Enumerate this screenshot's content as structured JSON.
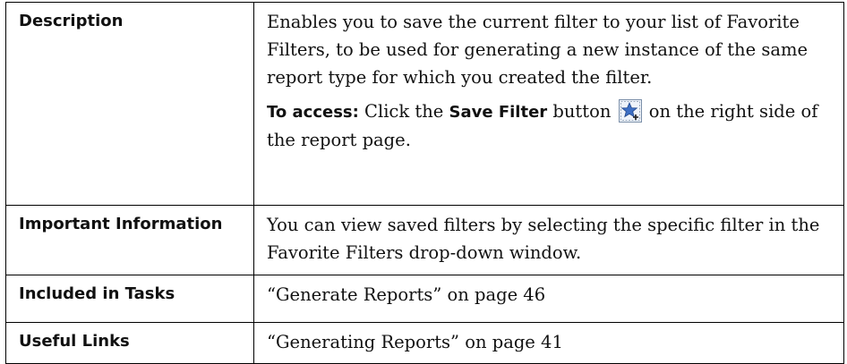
{
  "rows": {
    "description": {
      "label": "Description",
      "text": "Enables you to save the current filter to your list of Favorite Filters, to be used for generating a new instance of the same report type for which you created the filter.",
      "access_prefix": "To access:",
      "access_text_1": " Click the ",
      "access_button_name": "Save Filter",
      "access_text_2": " button ",
      "access_text_3": " on the right side of the report page."
    },
    "important_info": {
      "label": "Important Information",
      "text": "You can view saved filters by selecting the specific filter in the Favorite Filters drop-down window."
    },
    "included_in_tasks": {
      "label": "Included in Tasks",
      "link_text": "“Generate Reports” on page 46"
    },
    "useful_links": {
      "label": "Useful Links",
      "link_text": "“Generating Reports” on page 41"
    }
  },
  "icons": {
    "save_filter": "star-save-filter-icon"
  },
  "colors": {
    "border": "#000000",
    "text": "#111111",
    "icon_star": "#3d6fc4",
    "icon_frame": "#7a8ea8"
  }
}
